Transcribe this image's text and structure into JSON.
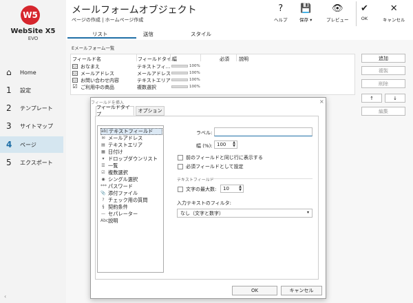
{
  "app": {
    "logo_initials": "W5",
    "logo_name": "WebSite X5",
    "logo_edition": "EVO"
  },
  "sidebar": {
    "items": [
      {
        "num": "⌂",
        "label": "Home"
      },
      {
        "num": "1",
        "label": "設定"
      },
      {
        "num": "2",
        "label": "テンプレート"
      },
      {
        "num": "3",
        "label": "サイトマップ"
      },
      {
        "num": "4",
        "label": "ページ"
      },
      {
        "num": "5",
        "label": "エクスポート"
      }
    ],
    "collapse": "‹"
  },
  "header": {
    "title": "メールフォームオブジェクト",
    "breadcrumb": "ページの作成 | ホームページ作成",
    "toolbar": [
      {
        "icon": "?",
        "label": "ヘルプ"
      },
      {
        "icon": "💾",
        "label": "保存 ▾"
      },
      {
        "icon": "👁",
        "label": "プレビュー"
      }
    ],
    "ok_label": "OK",
    "cancel_label": "キャンセル"
  },
  "tabs": [
    "リスト",
    "送信",
    "スタイル"
  ],
  "main": {
    "section": "Eメールフォーム一覧",
    "columns": [
      "フィールド名",
      "フィールドタイ...",
      "幅",
      "必須",
      "説明"
    ],
    "rows": [
      {
        "icon": "▭",
        "name": "おなまえ",
        "type": "テキストフィ...",
        "width": "100%"
      },
      {
        "icon": "▭",
        "name": "メールアドレス",
        "type": "メールアドレス",
        "width": "100%"
      },
      {
        "icon": "▭",
        "name": "お問い合わせ内容",
        "type": "テキストエリア",
        "width": "100%"
      },
      {
        "icon": "☑",
        "name": "ご利用中の商品",
        "type": "複数選択",
        "width": "100%"
      }
    ],
    "buttons": {
      "add": "追加",
      "duplicate": "複製",
      "delete": "削除",
      "up": "↑",
      "down": "↓",
      "edit": "編集"
    }
  },
  "dialog": {
    "title": "フィールドを挿入",
    "close": "×",
    "tabs": [
      "フィールドタイプ",
      "オプション"
    ],
    "field_types": [
      {
        "icon": "ab|",
        "label": "テキストフィールド"
      },
      {
        "icon": "✉",
        "label": "メールアドレス"
      },
      {
        "icon": "▤",
        "label": "テキストエリア"
      },
      {
        "icon": "▦",
        "label": "日付け"
      },
      {
        "icon": "▾",
        "label": "ドロップダウンリスト"
      },
      {
        "icon": "☰",
        "label": "一覧"
      },
      {
        "icon": "☑",
        "label": "複数選択"
      },
      {
        "icon": "◉",
        "label": "シングル選択"
      },
      {
        "icon": "***",
        "label": "パスワード"
      },
      {
        "icon": "📎",
        "label": "添付ファイル"
      },
      {
        "icon": "?",
        "label": "チェック用の質問"
      },
      {
        "icon": "§",
        "label": "契約条件"
      },
      {
        "icon": "—",
        "label": "セパレーター"
      },
      {
        "icon": "Abc",
        "label": "説明"
      }
    ],
    "label_caption": "ラベル:",
    "label_value": "",
    "width_caption": "幅 (%):",
    "width_value": "100",
    "same_row": "前のフィールドと同じ行に表示する",
    "required": "必須フィールドとして設定",
    "group_title": "テキストフィールド",
    "max_chars_caption": "文字の最大数:",
    "max_chars_value": "10",
    "filter_caption": "入力テキストのフィルタ:",
    "filter_value": "なし（文字と数字）",
    "ok": "OK",
    "cancel": "キャンセル"
  }
}
